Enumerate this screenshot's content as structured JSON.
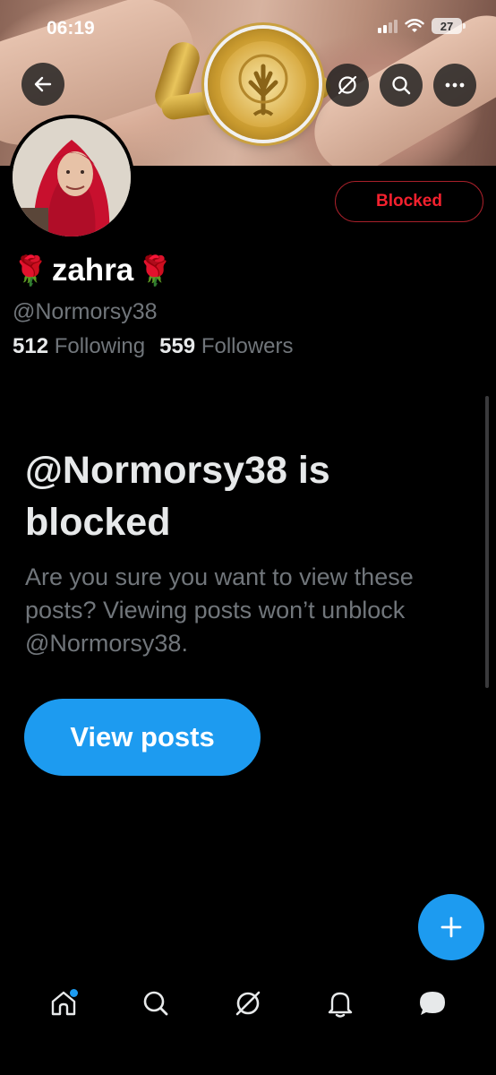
{
  "status_bar": {
    "time": "06:19",
    "battery": "27"
  },
  "header": {
    "back_icon": "arrow-left-icon",
    "actions": [
      "grok-icon",
      "search-icon",
      "more-icon"
    ]
  },
  "profile": {
    "display_name": "zahra",
    "emoji_left": "🌹",
    "emoji_right": "🌹",
    "handle": "@Normorsy38",
    "following_count": "512",
    "following_label": "Following",
    "followers_count": "559",
    "followers_label": "Followers",
    "blocked_label": "Blocked"
  },
  "blocked_notice": {
    "title": "@Normorsy38 is blocked",
    "description": "Are you sure you want to view these posts? Viewing posts won’t unblock @Normorsy38.",
    "button_label": "View posts"
  },
  "fab": {
    "icon": "plus-icon"
  },
  "bottom_nav": {
    "items": [
      "home-icon",
      "search-icon",
      "grok-icon",
      "notifications-icon",
      "messages-icon"
    ]
  },
  "colors": {
    "accent": "#1d9bf0",
    "blocked": "#f4212e",
    "muted": "#71767b"
  }
}
